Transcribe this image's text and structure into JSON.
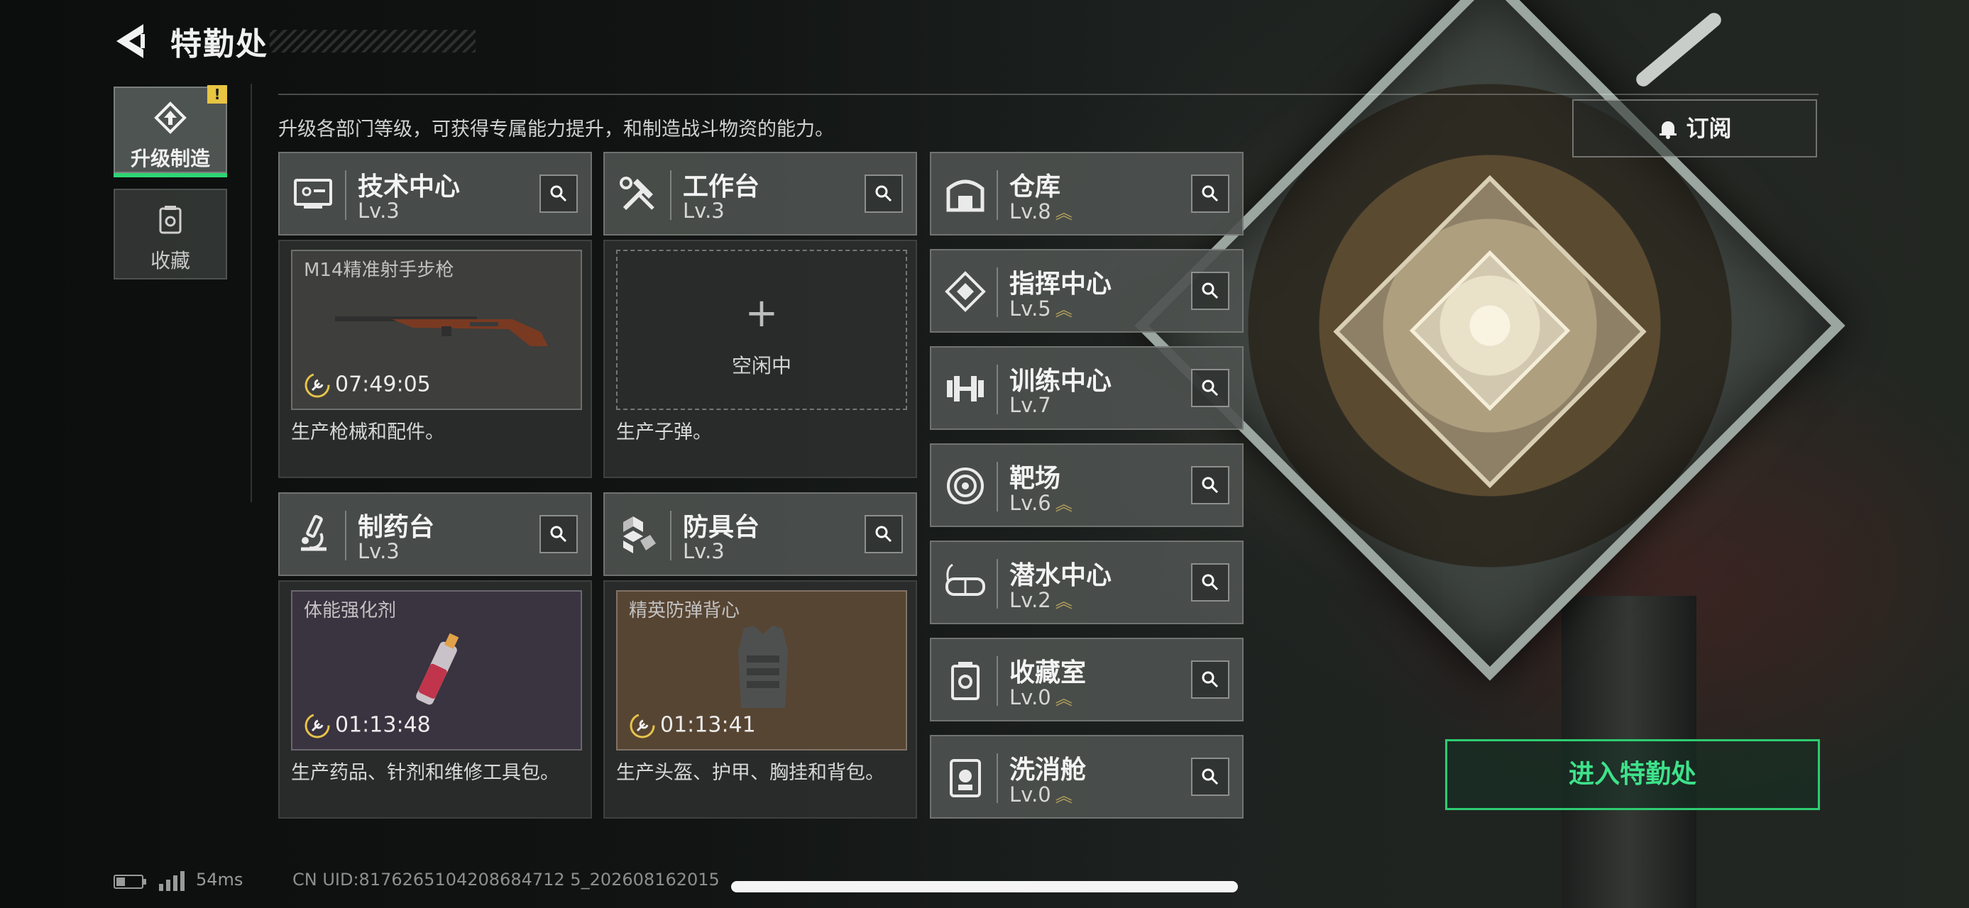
{
  "header": {
    "title": "特勤处",
    "description": "升级各部门等级，可获得专属能力提升，和制造战斗物资的能力。"
  },
  "nav": {
    "tabs": [
      {
        "label": "升级制造",
        "active": true,
        "icon": "upgrade-icon"
      },
      {
        "label": "收藏",
        "active": false,
        "icon": "collection-icon"
      }
    ],
    "alert_badge": "!"
  },
  "departments": {
    "tech_center": {
      "name": "技术中心",
      "level": "Lv.3",
      "product": "M14精准射手步枪",
      "timer": "07:49:05",
      "description": "生产枪械和配件。"
    },
    "workbench": {
      "name": "工作台",
      "level": "Lv.3",
      "empty_label": "空闲中",
      "plus": "+",
      "description": "生产子弹。"
    },
    "pharmacy": {
      "name": "制药台",
      "level": "Lv.3",
      "product": "体能强化剂",
      "timer": "01:13:48",
      "description": "生产药品、针剂和维修工具包。"
    },
    "armor": {
      "name": "防具台",
      "level": "Lv.3",
      "product": "精英防弹背心",
      "timer": "01:13:41",
      "description": "生产头盔、护甲、胸挂和背包。"
    }
  },
  "facilities": [
    {
      "name": "仓库",
      "level": "Lv.8",
      "upgradable": true,
      "icon": "warehouse-icon"
    },
    {
      "name": "指挥中心",
      "level": "Lv.5",
      "upgradable": true,
      "icon": "command-icon"
    },
    {
      "name": "训练中心",
      "level": "Lv.7",
      "upgradable": false,
      "icon": "dumbbell-icon"
    },
    {
      "name": "靶场",
      "level": "Lv.6",
      "upgradable": true,
      "icon": "target-icon"
    },
    {
      "name": "潜水中心",
      "level": "Lv.2",
      "upgradable": true,
      "icon": "diving-mask-icon"
    },
    {
      "name": "收藏室",
      "level": "Lv.0",
      "upgradable": true,
      "icon": "collection-room-icon"
    },
    {
      "name": "洗消舱",
      "level": "Lv.0",
      "upgradable": true,
      "icon": "decontamination-icon"
    }
  ],
  "actions": {
    "subscribe": "订阅",
    "enter": "进入特勤处"
  },
  "status": {
    "ping": "54ms",
    "uid": "CN UID:8176265104208684712 5_202608162015"
  },
  "colors": {
    "accent_green": "#2ecc71",
    "alert_yellow": "#e8c542",
    "upgrade_chevron": "#b9a45a"
  }
}
